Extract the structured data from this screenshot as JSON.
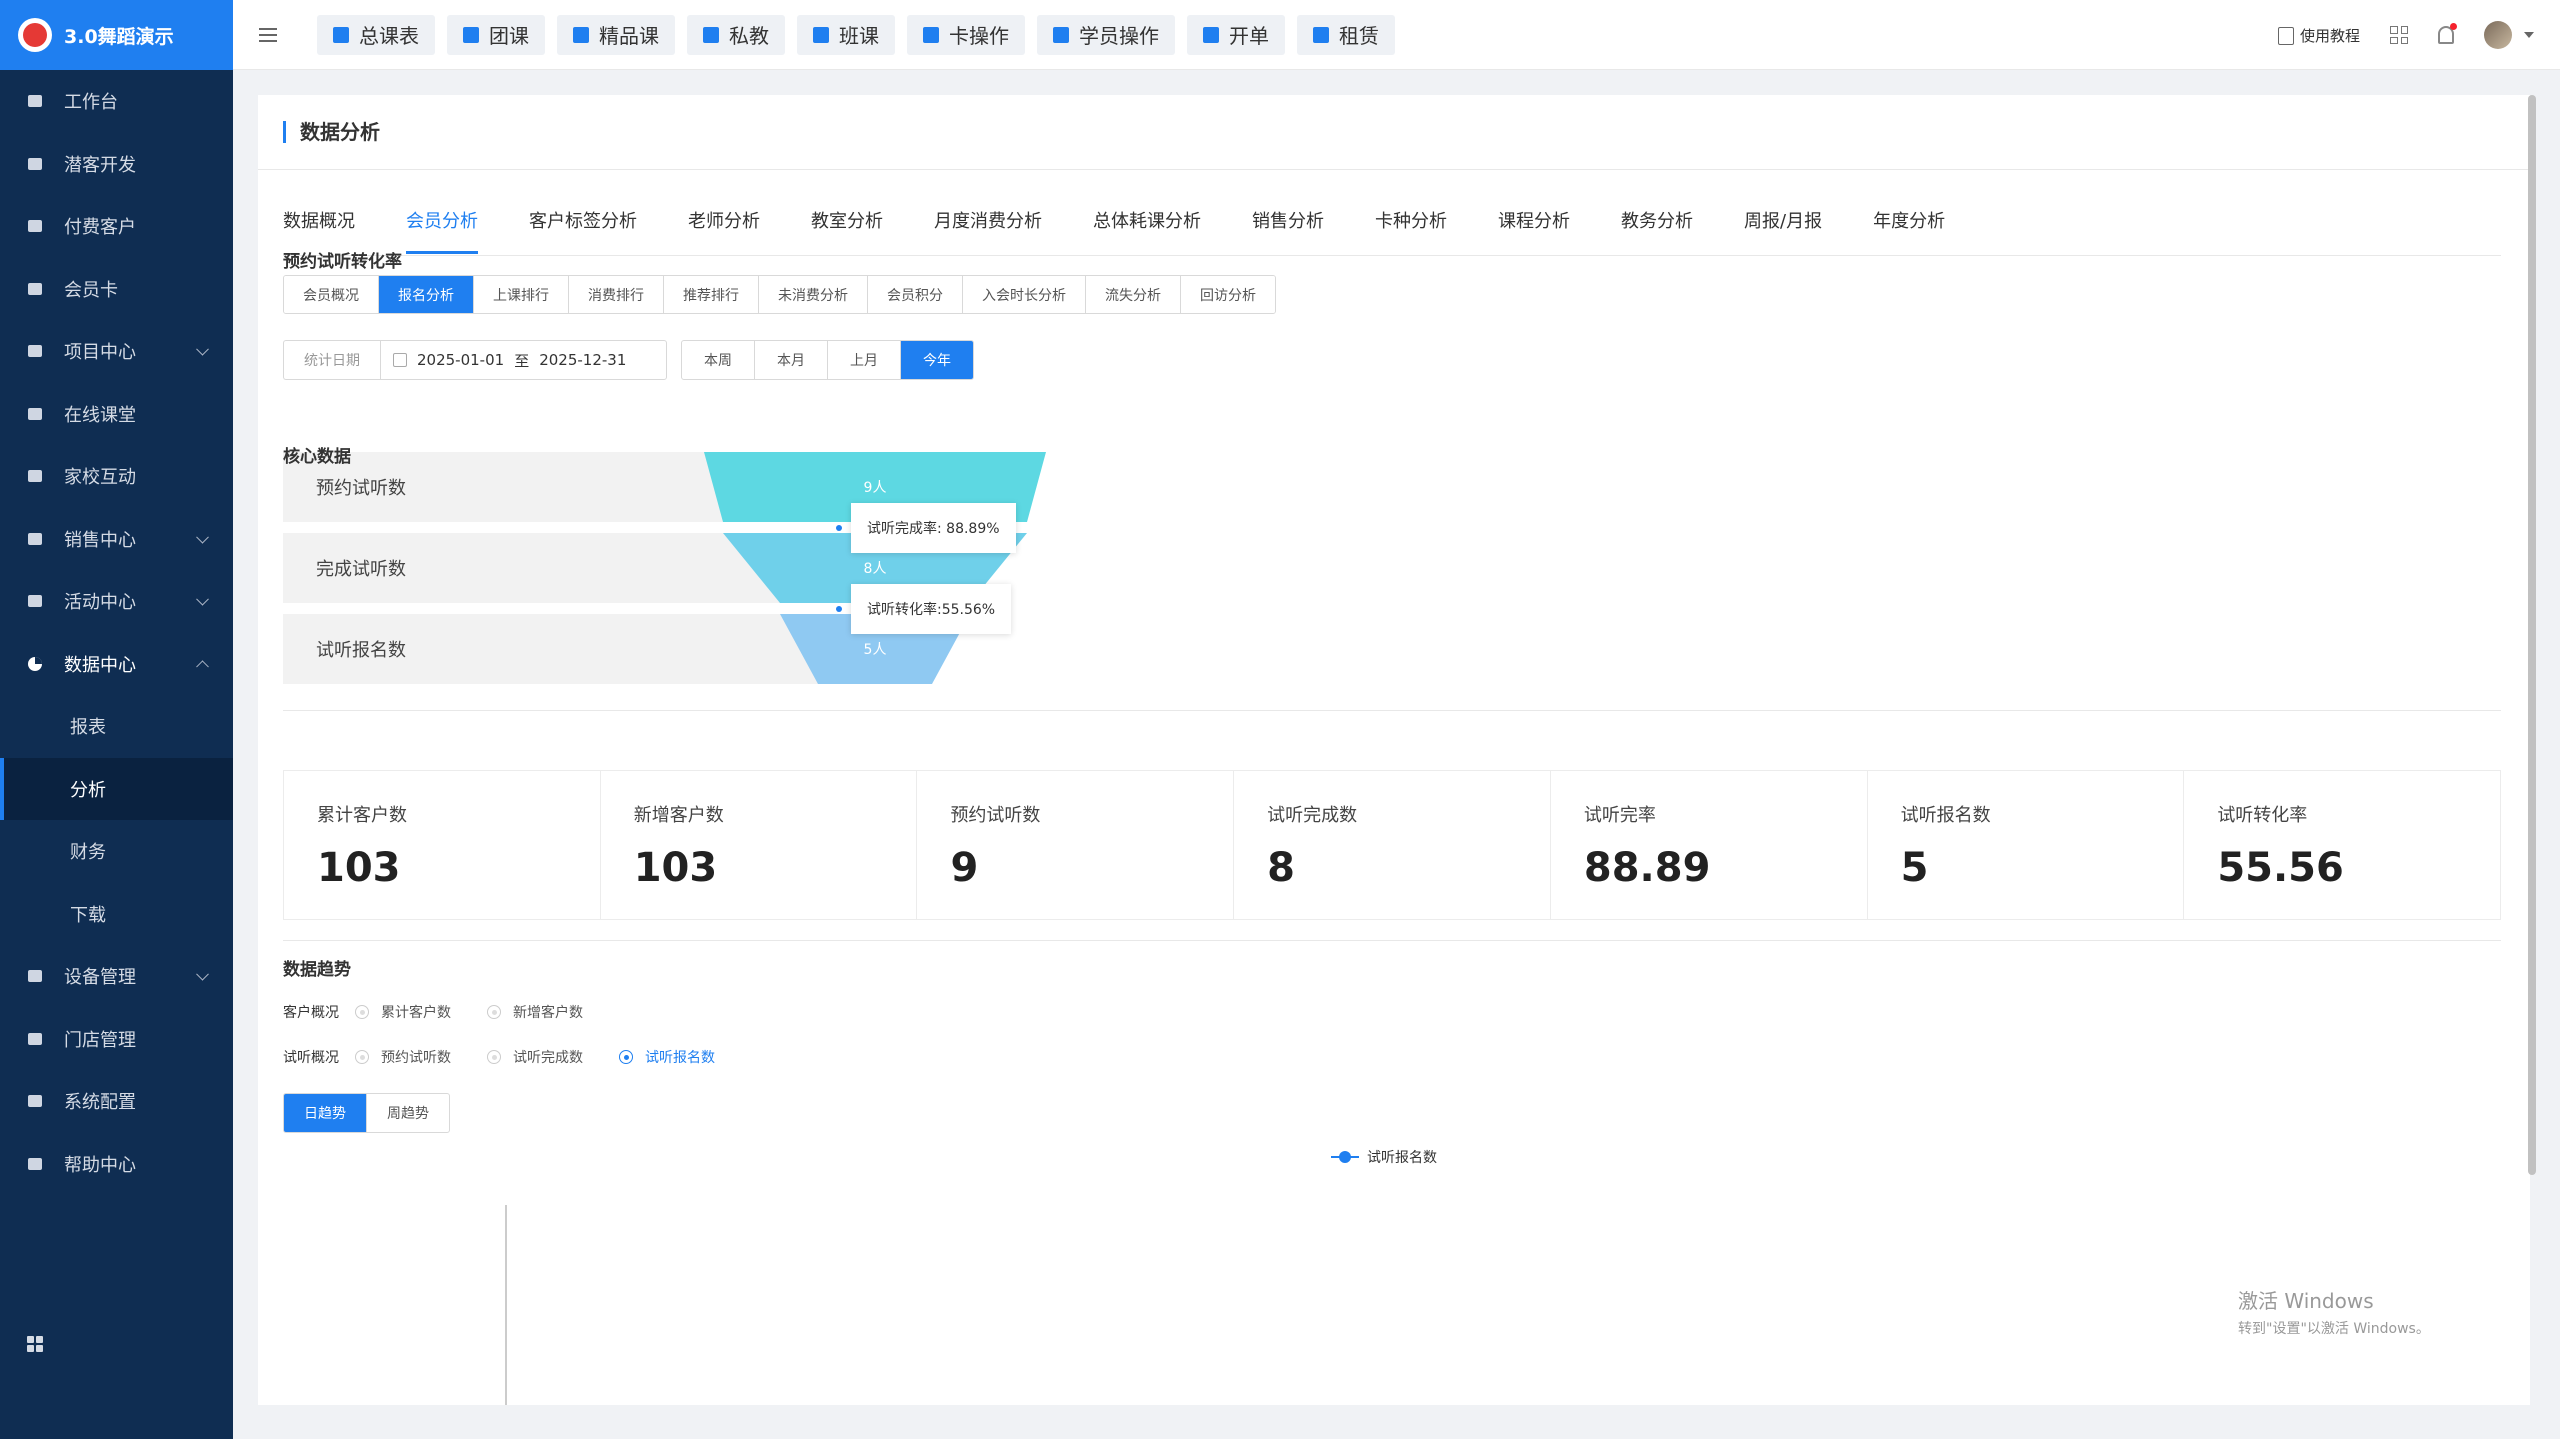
{
  "app": {
    "logo_text": "3.0舞蹈演示",
    "brand_color": "#1f7ff0",
    "sidebar_color": "#0f2d52"
  },
  "sidebar": {
    "items": [
      {
        "label": "工作台",
        "icon": "desk-icon"
      },
      {
        "label": "潜客开发",
        "icon": "id-card-icon"
      },
      {
        "label": "付费客户",
        "icon": "users-icon"
      },
      {
        "label": "会员卡",
        "icon": "card-icon"
      },
      {
        "label": "项目中心",
        "icon": "project-icon",
        "expandable": true
      },
      {
        "label": "在线课堂",
        "icon": "classroom-icon"
      },
      {
        "label": "家校互动",
        "icon": "contact-icon"
      },
      {
        "label": "销售中心",
        "icon": "tag-icon",
        "expandable": true
      },
      {
        "label": "活动中心",
        "icon": "activity-icon",
        "expandable": true
      },
      {
        "label": "数据中心",
        "icon": "pie-icon",
        "expanded": true
      }
    ],
    "data_center_children": [
      "报表",
      "分析",
      "财务",
      "下载"
    ],
    "active_child": "分析",
    "items_after": [
      {
        "label": "设备管理",
        "icon": "device-icon",
        "expandable": true
      },
      {
        "label": "门店管理",
        "icon": "store-icon"
      },
      {
        "label": "系统配置",
        "icon": "config-icon"
      },
      {
        "label": "帮助中心",
        "icon": "help-icon"
      }
    ]
  },
  "topbar": {
    "quick_buttons": [
      "总课表",
      "团课",
      "精品课",
      "私教",
      "班课",
      "卡操作",
      "学员操作",
      "开单",
      "租赁"
    ],
    "tutorial_label": "使用教程"
  },
  "page": {
    "title": "数据分析",
    "tabs": [
      "数据概况",
      "会员分析",
      "客户标签分析",
      "老师分析",
      "教室分析",
      "月度消费分析",
      "总体耗课分析",
      "销售分析",
      "卡种分析",
      "课程分析",
      "教务分析",
      "周报/月报",
      "年度分析"
    ],
    "active_tab": "会员分析",
    "subtabs": [
      "会员概况",
      "报名分析",
      "上课排行",
      "消费排行",
      "推荐排行",
      "未消费分析",
      "会员积分",
      "入会时长分析",
      "流失分析",
      "回访分析"
    ],
    "active_subtab": "报名分析",
    "date_label": "统计日期",
    "date_start": "2025-01-01",
    "date_sep": "至",
    "date_end": "2025-12-31",
    "range_buttons": [
      "本周",
      "本月",
      "上月",
      "今年"
    ],
    "active_range": "今年"
  },
  "funnel": {
    "title": "预约试听转化率",
    "stages": [
      {
        "label": "预约试听数",
        "value_text": "9人",
        "value": 9,
        "color": "#5dd8e2"
      },
      {
        "label": "完成试听数",
        "value_text": "8人",
        "value": 8,
        "color": "#6fd0ea"
      },
      {
        "label": "试听报名数",
        "value_text": "5人",
        "value": 5,
        "color": "#8fc9f2"
      }
    ],
    "tips": [
      "试听完成率: 88.89%",
      "试听转化率:55.56%"
    ]
  },
  "core": {
    "title": "核心数据",
    "stats": [
      {
        "label": "累计客户数",
        "value": "103"
      },
      {
        "label": "新增客户数",
        "value": "103"
      },
      {
        "label": "预约试听数",
        "value": "9"
      },
      {
        "label": "试听完成数",
        "value": "8"
      },
      {
        "label": "试听完率",
        "value": "88.89"
      },
      {
        "label": "试听报名数",
        "value": "5"
      },
      {
        "label": "试听转化率",
        "value": "55.56"
      }
    ]
  },
  "trend": {
    "title": "数据趋势",
    "customer_label": "客户概况",
    "customer_options": [
      "累计客户数",
      "新增客户数"
    ],
    "trial_label": "试听概况",
    "trial_options": [
      "预约试听数",
      "试听完成数",
      "试听报名数"
    ],
    "selected_option": "试听报名数",
    "view_buttons": [
      "日趋势",
      "周趋势"
    ],
    "active_view": "日趋势",
    "legend": "试听报名数"
  },
  "watermark": {
    "line1": "激活 Windows",
    "line2": "转到\"设置\"以激活 Windows。"
  }
}
